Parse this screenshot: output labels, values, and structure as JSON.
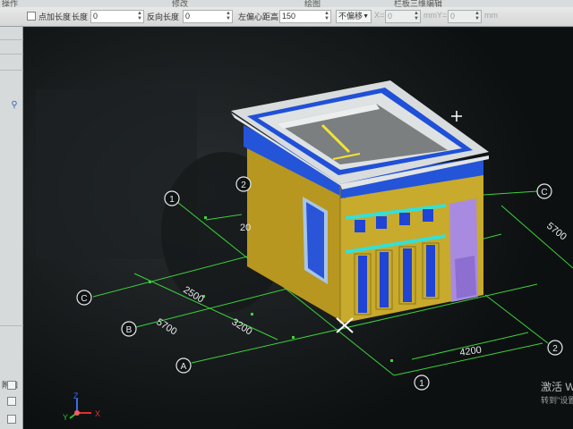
{
  "menu": {
    "item1": "操作",
    "item2": "修改",
    "item3": "绘图",
    "item4": "栏板三维编辑"
  },
  "toolbar": {
    "point_length_label": "点加长度",
    "length_label": "长度",
    "length_value": "0",
    "reverse_length_label": "反向长度",
    "reverse_length_value": "0",
    "left_offset_label": "左偏心距高",
    "left_offset_value": "150",
    "offset_mode": "不偏移",
    "x_label": "X=",
    "x_value": "0",
    "unit1": "mm",
    "y_label": "Y=",
    "y_value": "0",
    "unit2": "mm"
  },
  "left_panel": {
    "fujia_label": "附加"
  },
  "axes": {
    "row_C_left": "C",
    "row_B": "B",
    "row_A": "A",
    "col_1_left": "1",
    "col_2_left": "2",
    "row_C_right": "C",
    "col_2_right": "2",
    "col_1_right": "1"
  },
  "dimensions": {
    "d_2500": "2500",
    "d_3200": "3200",
    "d_5700_left": "5700",
    "d_20": "20",
    "d_4200": "4200",
    "d_5700_right": "5700"
  },
  "coordinate_axes": {
    "z": "Z",
    "y": "Y",
    "x": "X"
  },
  "watermark": {
    "main": "激活 W",
    "sub": "转到\"设置"
  },
  "colors": {
    "wall": "#c8aa2c",
    "beam": "#2454d8",
    "window": "#1f44d6",
    "door": "#a88be0",
    "grid": "#3cd23c",
    "parapet": "#d8dcdc"
  }
}
